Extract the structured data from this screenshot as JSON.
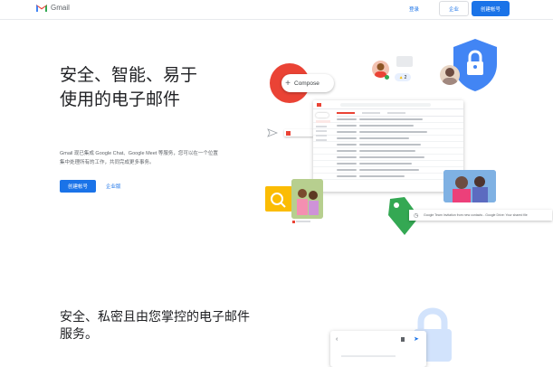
{
  "header": {
    "brand": "Gmail",
    "signin_label": "登录",
    "business_label": "企业",
    "create_account_label": "创建帐号"
  },
  "hero": {
    "title": "安全、智能、易于使用的电子邮件",
    "description": "Gmail 现已集成 Google Chat、Google Meet 等服务，您可以在一个位置集中处理所有的工作，共同完成更多事务。",
    "primary_cta": "创建帐号",
    "secondary_cta": "企业版"
  },
  "illustration": {
    "compose_label": "Compose",
    "reaction_count": "2",
    "chip_text": "Google Team Invitation from new contacts - Google Drive: Your shared file"
  },
  "section2": {
    "title": "安全、私密且由您掌控的电子邮件服务。"
  },
  "colors": {
    "accent": "#1a73e8",
    "red": "#ea4335",
    "green": "#34a853",
    "yellow": "#fbbc04",
    "blue_shield": "#4285f4"
  }
}
